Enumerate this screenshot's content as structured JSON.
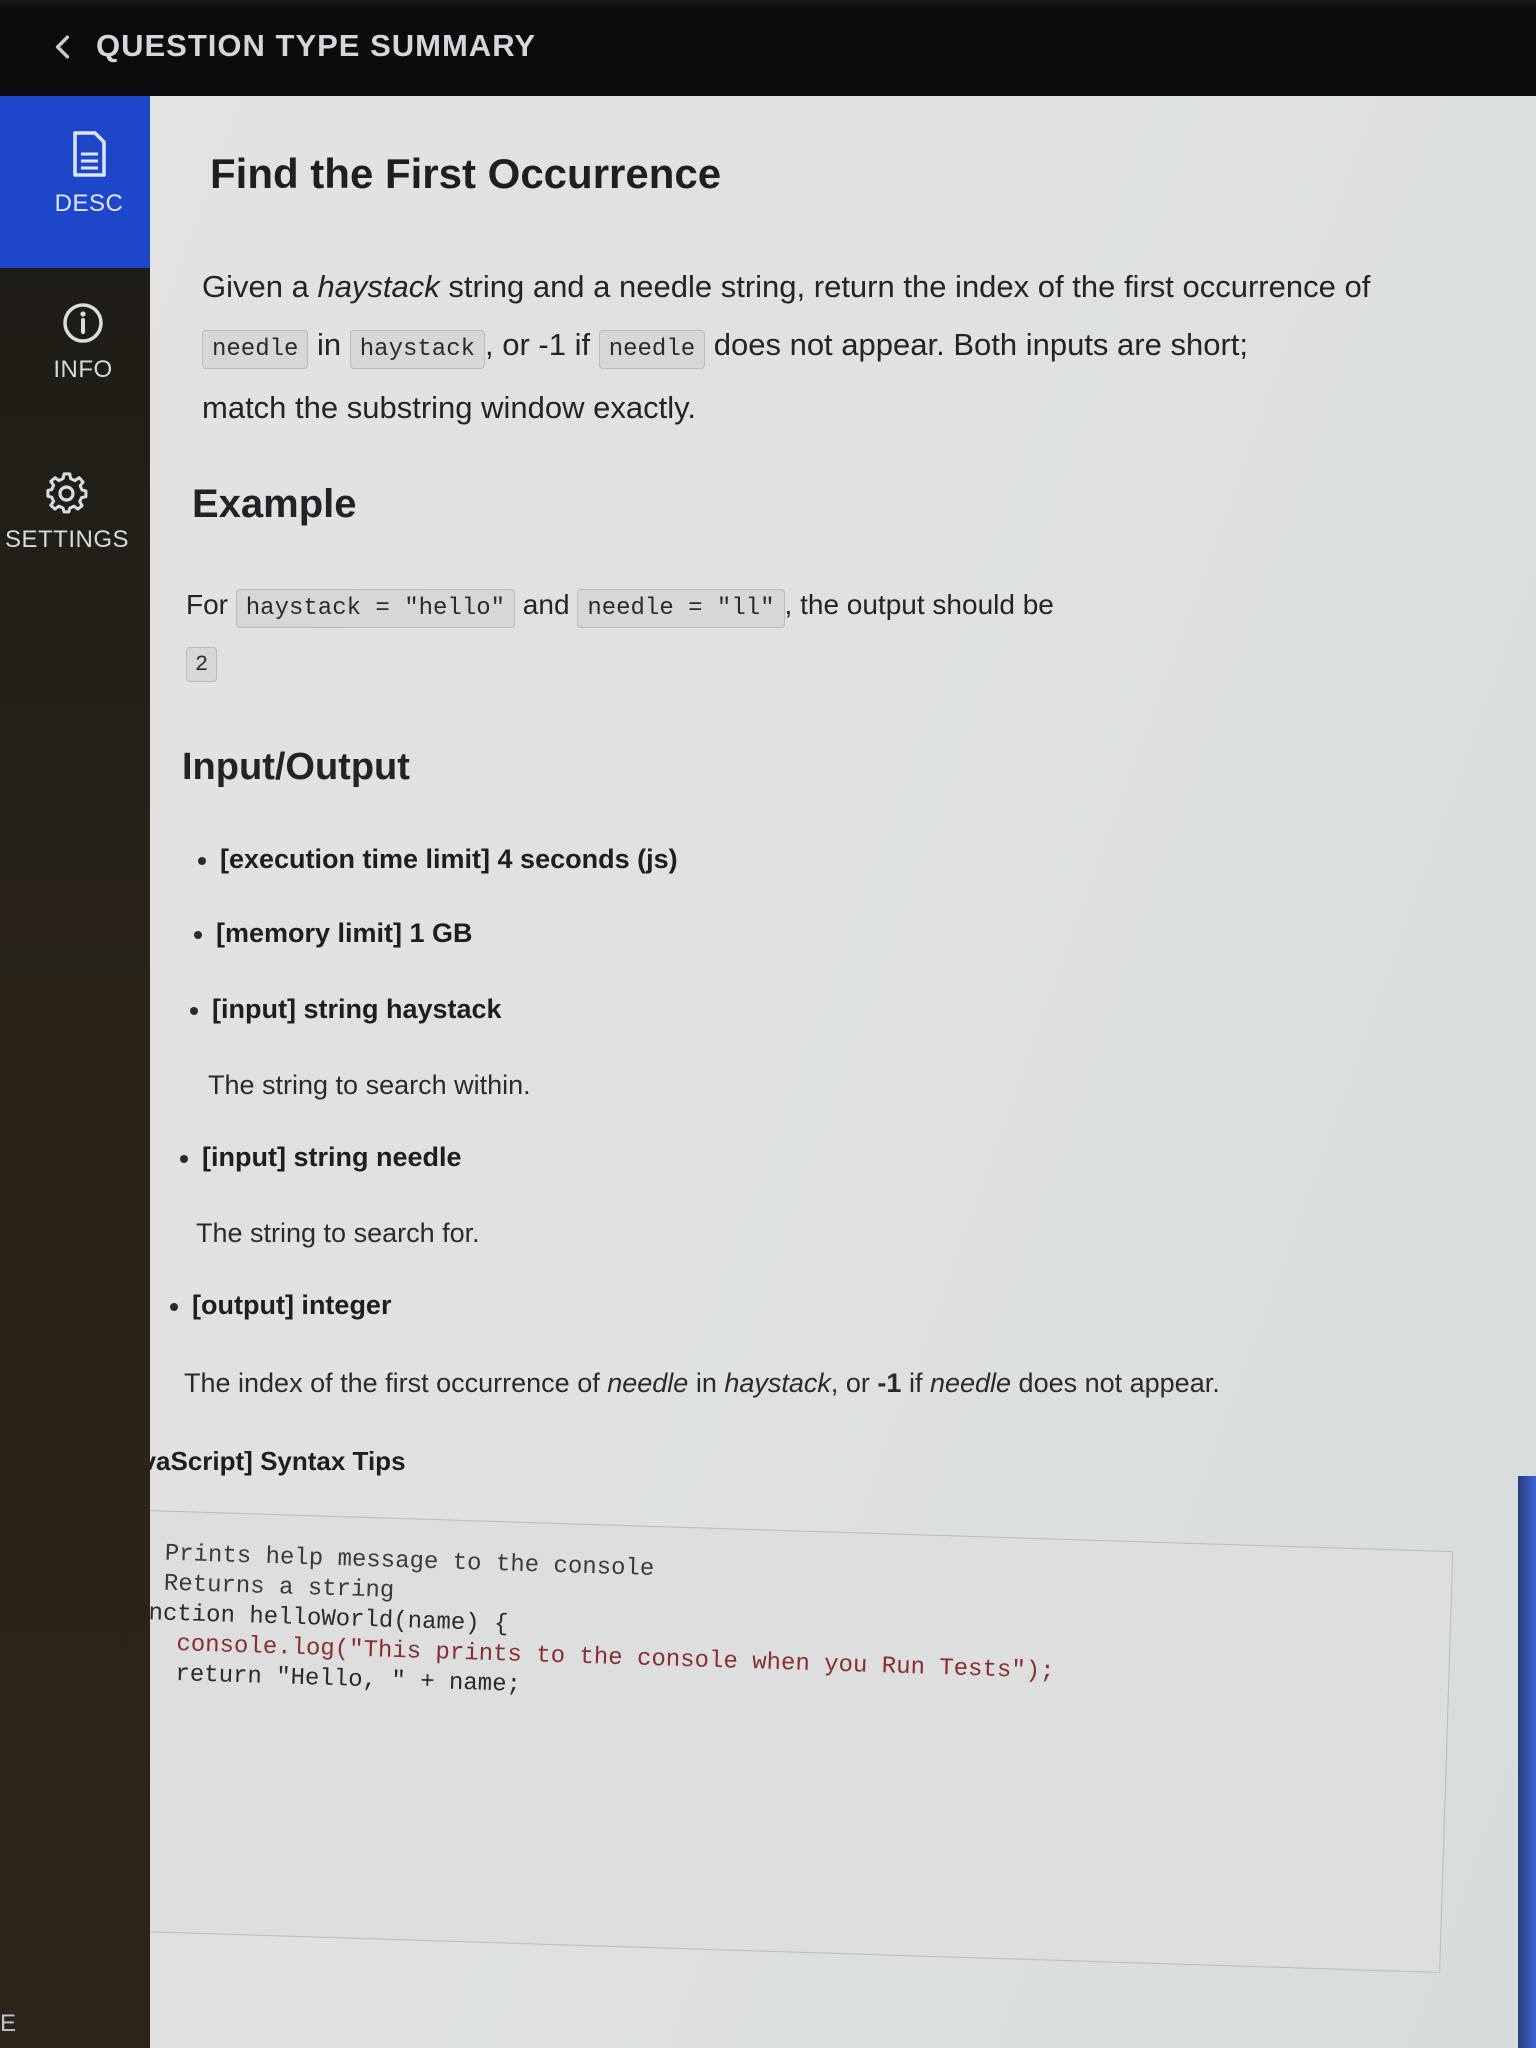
{
  "header": {
    "title": "QUESTION TYPE SUMMARY"
  },
  "sidebar": {
    "items": [
      {
        "label": "DESC",
        "icon": "document-icon",
        "active": true
      },
      {
        "label": "INFO",
        "icon": "info-icon",
        "active": false
      },
      {
        "label": "SETTINGS",
        "icon": "gear-icon",
        "active": false
      }
    ]
  },
  "main": {
    "title": "Find the First Occurrence",
    "description": {
      "p1": "Given a ",
      "p1_em": "haystack",
      "p2": " string and a needle string, return the index of the first occurrence of",
      "code_needle": "needle",
      "in": " in ",
      "code_haystack": "haystack",
      "or": ", or -1 if ",
      "code_needle2": "needle",
      "tail": " does not appear. Both inputs are short;",
      "line3": "match the substring window exactly."
    },
    "example": {
      "heading": "Example",
      "for": "For ",
      "code1": "haystack = \"hello\"",
      "and": " and ",
      "code2": "needle = \"ll\"",
      "tail": ", the output should be",
      "output": "2"
    },
    "io": {
      "heading": "Input/Output",
      "items": [
        {
          "label": "[execution time limit] 4 seconds (js)",
          "desc": ""
        },
        {
          "label": "[memory limit] 1 GB",
          "desc": ""
        },
        {
          "label": "[input] string haystack",
          "desc": "The string to search within."
        },
        {
          "label": "[input] string needle",
          "desc": "The string to search for."
        },
        {
          "label": "[output] integer",
          "desc": ""
        }
      ],
      "output_desc": {
        "a": "The index of the first occurrence of ",
        "b": "needle",
        "c": " in ",
        "d": "haystack",
        "e": ", or ",
        "f": "-1",
        "g": " if ",
        "h": "needle",
        "i": " does not appear."
      }
    },
    "syntax": {
      "heading": "[JavaScript] Syntax Tips",
      "lines": [
        "// Prints help message to the console",
        "// Returns a string",
        "function helloWorld(name) {",
        "    console.log(\"This prints to the console when you Run Tests\");",
        "    return \"Hello, \" + name;",
        "}"
      ]
    }
  },
  "footer": {
    "corner_text": "E"
  },
  "colors": {
    "accent": "#1e46c8",
    "header_bg": "#0b0a0c",
    "sidebar_bg": "#2a2418",
    "content_bg": "#e0e2e0"
  }
}
